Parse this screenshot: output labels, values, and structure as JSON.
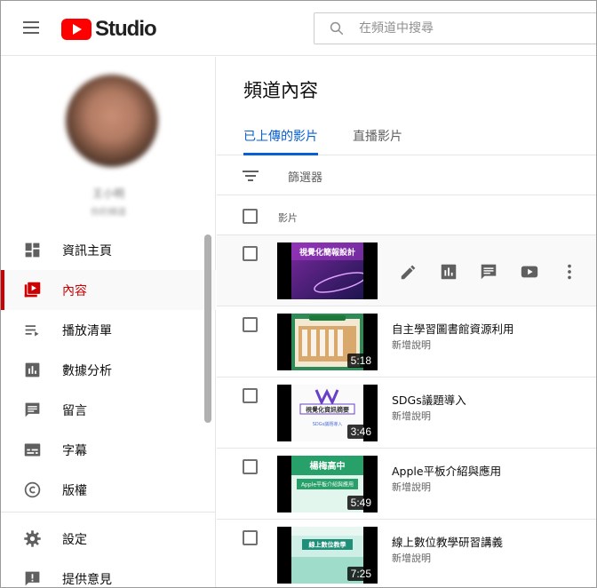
{
  "header": {
    "logo_text": "Studio",
    "search_placeholder": "在頻道中搜尋"
  },
  "sidebar": {
    "channel_name": "王小明",
    "channel_sub": "你的頻道",
    "items": [
      {
        "label": "資訊主頁",
        "icon": "dashboard-icon"
      },
      {
        "label": "內容",
        "icon": "content-icon",
        "active": true
      },
      {
        "label": "播放清單",
        "icon": "playlist-icon"
      },
      {
        "label": "數據分析",
        "icon": "analytics-icon"
      },
      {
        "label": "留言",
        "icon": "comments-icon"
      },
      {
        "label": "字幕",
        "icon": "subtitles-icon"
      },
      {
        "label": "版權",
        "icon": "copyright-icon"
      }
    ],
    "bottom_items": [
      {
        "label": "設定",
        "icon": "gear-icon"
      },
      {
        "label": "提供意見",
        "icon": "feedback-icon"
      }
    ]
  },
  "main": {
    "title": "頻道內容",
    "tabs": [
      {
        "label": "已上傳的影片",
        "active": true
      },
      {
        "label": "直播影片",
        "active": false
      }
    ],
    "filter_label": "篩選器",
    "column_video": "影片",
    "videos": [
      {
        "thumb_title": "視覺化簡報設計",
        "title": "",
        "desc": "",
        "duration": "",
        "hover": true
      },
      {
        "thumb_title": "",
        "title": "自主學習圖書館資源利用",
        "desc": "新增說明",
        "duration": "5:18"
      },
      {
        "thumb_title": "視覺化資訊摘要",
        "thumb_sub": "SDGs議題導入",
        "title": "SDGs議題導入",
        "desc": "新增說明",
        "duration": "3:46"
      },
      {
        "thumb_title": "楊梅高中",
        "thumb_sub": "Apple平板介紹與應用",
        "title": "Apple平板介紹與應用",
        "desc": "新增說明",
        "duration": "5:49"
      },
      {
        "thumb_title": "線上數位教學",
        "title": "線上數位教學研習講義",
        "desc": "新增說明",
        "duration": "7:25"
      }
    ]
  },
  "colors": {
    "brand_red": "#ff0000",
    "active_red": "#cc0000",
    "tab_blue": "#065fd4"
  }
}
